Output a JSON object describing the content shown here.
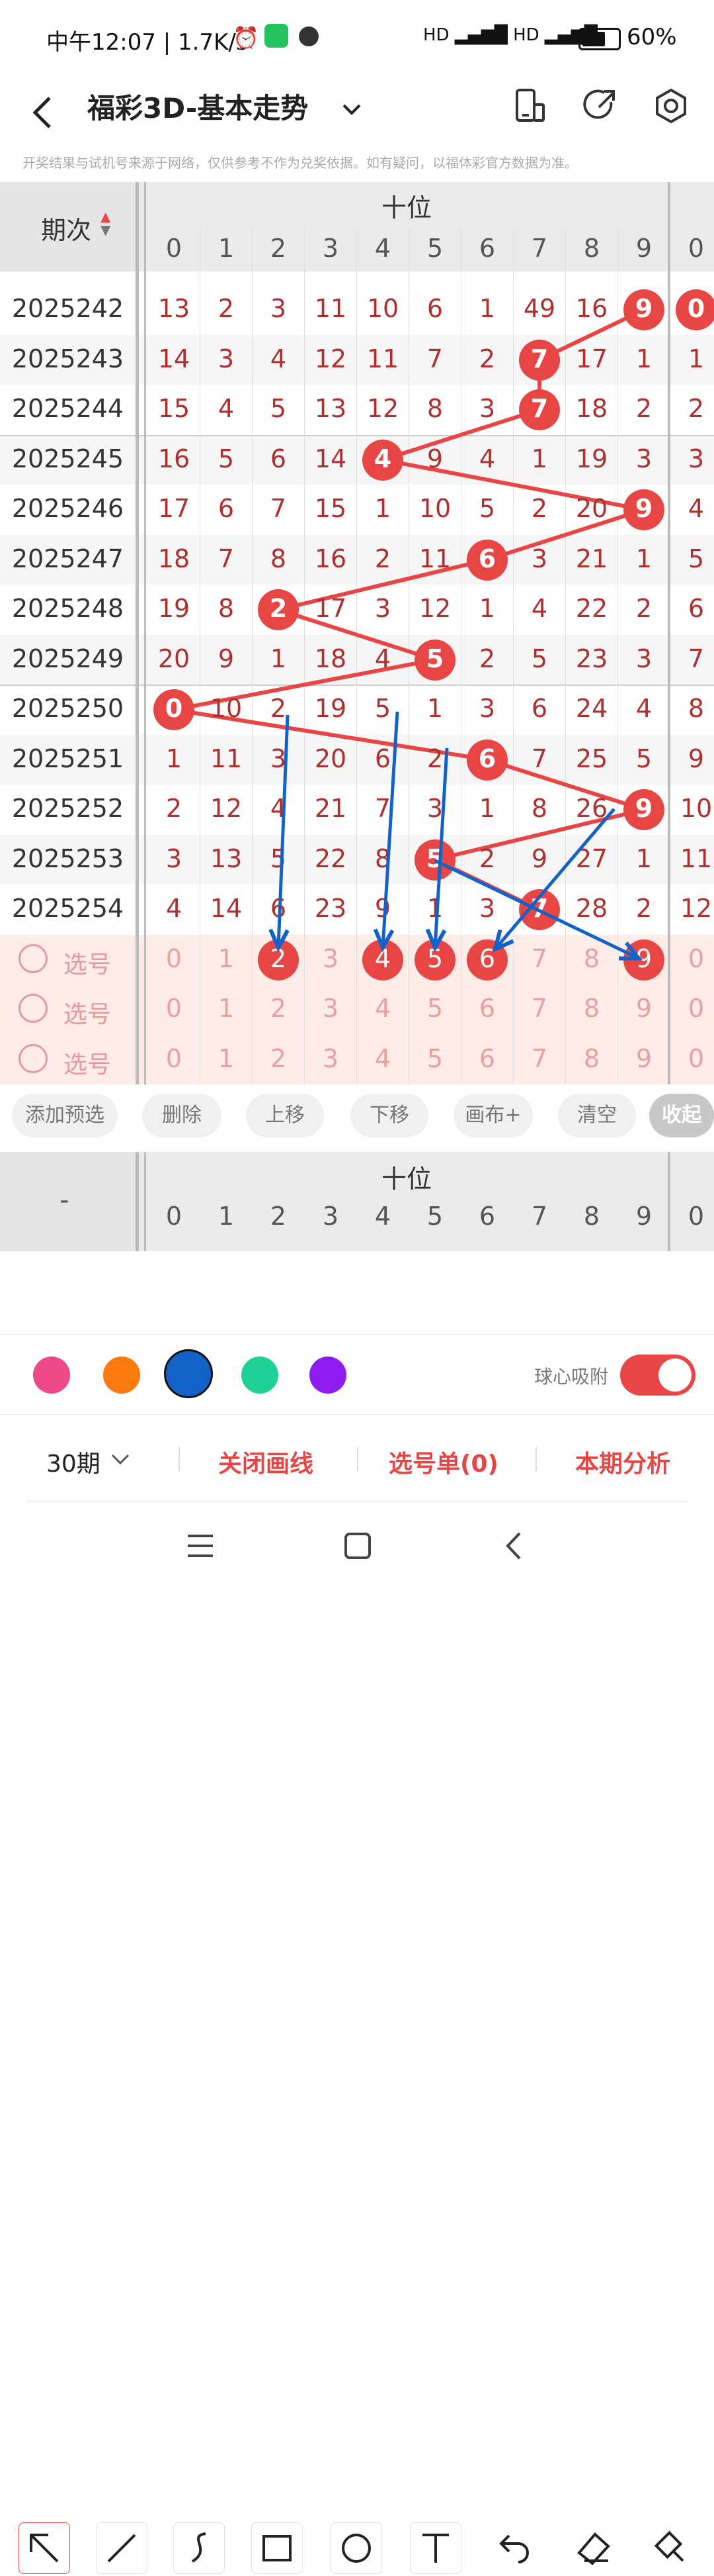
{
  "status": {
    "time_speed": "中午12:07 | 1.7K/s",
    "battery": "60%"
  },
  "header": {
    "title": "福彩3D-基本走势",
    "notice": "开奖结果与试机号来源于网络，仅供参考不作为兑奖依据。如有疑问，以福体彩官方数据为准。"
  },
  "table": {
    "period_header": "期次",
    "section_header": "十位",
    "digit_headers": [
      "0",
      "1",
      "2",
      "3",
      "4",
      "5",
      "6",
      "7",
      "8",
      "9",
      "0"
    ],
    "rows": [
      {
        "period": "2025242",
        "cells": [
          "13",
          "2",
          "3",
          "11",
          "10",
          "6",
          "1",
          "49",
          "16",
          "9",
          "0"
        ],
        "hit": 9,
        "extra_hit": true
      },
      {
        "period": "2025243",
        "cells": [
          "14",
          "3",
          "4",
          "12",
          "11",
          "7",
          "2",
          "7",
          "17",
          "1",
          "1"
        ],
        "hit": 7
      },
      {
        "period": "2025244",
        "cells": [
          "15",
          "4",
          "5",
          "13",
          "12",
          "8",
          "3",
          "7",
          "18",
          "2",
          "2"
        ],
        "hit": 7
      },
      {
        "period": "2025245",
        "cells": [
          "16",
          "5",
          "6",
          "14",
          "4",
          "9",
          "4",
          "1",
          "19",
          "3",
          "3"
        ],
        "hit": 4
      },
      {
        "period": "2025246",
        "cells": [
          "17",
          "6",
          "7",
          "15",
          "1",
          "10",
          "5",
          "2",
          "20",
          "9",
          "4"
        ],
        "hit": 9
      },
      {
        "period": "2025247",
        "cells": [
          "18",
          "7",
          "8",
          "16",
          "2",
          "11",
          "6",
          "3",
          "21",
          "1",
          "5"
        ],
        "hit": 6
      },
      {
        "period": "2025248",
        "cells": [
          "19",
          "8",
          "2",
          "17",
          "3",
          "12",
          "1",
          "4",
          "22",
          "2",
          "6"
        ],
        "hit": 2
      },
      {
        "period": "2025249",
        "cells": [
          "20",
          "9",
          "1",
          "18",
          "4",
          "5",
          "2",
          "5",
          "23",
          "3",
          "7"
        ],
        "hit": 5
      },
      {
        "period": "2025250",
        "cells": [
          "0",
          "10",
          "2",
          "19",
          "5",
          "1",
          "3",
          "6",
          "24",
          "4",
          "8"
        ],
        "hit": 0
      },
      {
        "period": "2025251",
        "cells": [
          "1",
          "11",
          "3",
          "20",
          "6",
          "2",
          "6",
          "7",
          "25",
          "5",
          "9"
        ],
        "hit": 6
      },
      {
        "period": "2025252",
        "cells": [
          "2",
          "12",
          "4",
          "21",
          "7",
          "3",
          "1",
          "8",
          "26",
          "9",
          "10"
        ],
        "hit": 9
      },
      {
        "period": "2025253",
        "cells": [
          "3",
          "13",
          "5",
          "22",
          "8",
          "5",
          "2",
          "9",
          "27",
          "1",
          "11"
        ],
        "hit": 5
      },
      {
        "period": "2025254",
        "cells": [
          "4",
          "14",
          "6",
          "23",
          "9",
          "1",
          "3",
          "7",
          "28",
          "2",
          "12"
        ],
        "hit": 7
      }
    ],
    "pick_rows": [
      {
        "label": "选号",
        "cells": [
          "0",
          "1",
          "2",
          "3",
          "4",
          "5",
          "6",
          "7",
          "8",
          "9",
          "0"
        ],
        "selected": [
          2,
          4,
          5,
          6,
          9
        ]
      },
      {
        "label": "选号",
        "cells": [
          "0",
          "1",
          "2",
          "3",
          "4",
          "5",
          "6",
          "7",
          "8",
          "9",
          "0"
        ],
        "selected": []
      },
      {
        "label": "选号",
        "cells": [
          "0",
          "1",
          "2",
          "3",
          "4",
          "5",
          "6",
          "7",
          "8",
          "9",
          "0"
        ],
        "selected": []
      }
    ]
  },
  "actions": {
    "add": "添加预选",
    "delete": "删除",
    "up": "上移",
    "down": "下移",
    "canvas": "画布+",
    "clear": "清空",
    "collapse": "收起"
  },
  "lower_table": {
    "dash": "-",
    "section_header": "十位",
    "digit_headers": [
      "0",
      "1",
      "2",
      "3",
      "4",
      "5",
      "6",
      "7",
      "8",
      "9",
      "0"
    ]
  },
  "colors": {
    "accent": "#e84545",
    "pink": "#ee4a8a",
    "orange": "#fb7a10",
    "blue": "#1362c8",
    "green": "#1fd196",
    "purple": "#8e1cf0"
  },
  "snap": {
    "label": "球心吸附",
    "on": true
  },
  "bottom": {
    "periods": "30期",
    "close_lines": "关闭画线",
    "pick_list": "选号单(0)",
    "analysis": "本期分析"
  }
}
